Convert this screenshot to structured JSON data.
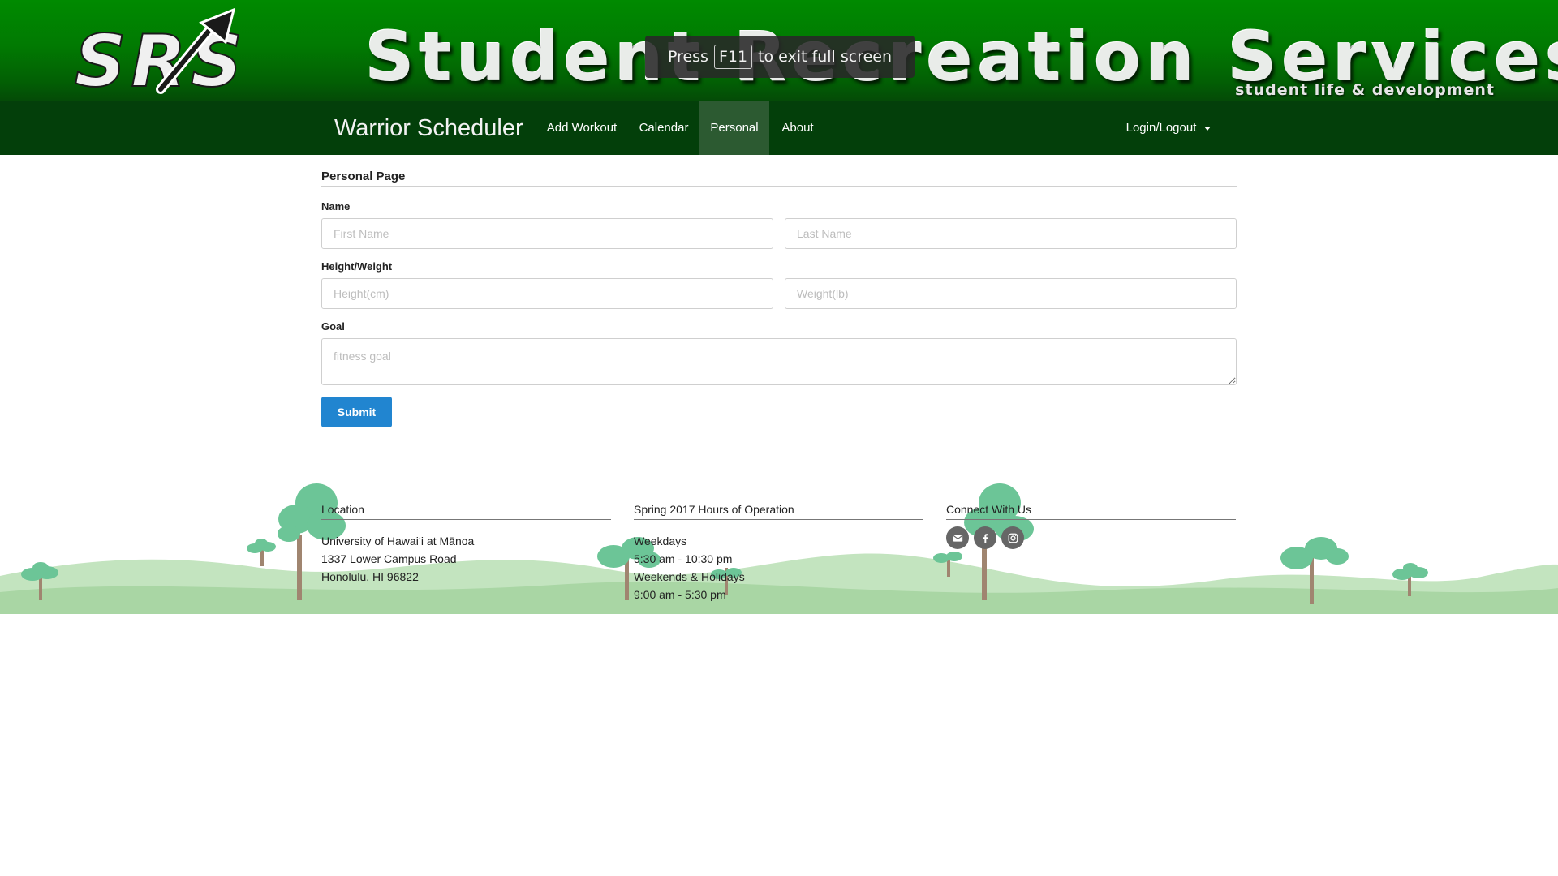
{
  "banner": {
    "logo_text": "SRS",
    "title": "Student Recreation Services",
    "subtitle": "student life & development",
    "colors": {
      "green_top": "#008a00",
      "green_bottom": "#044a07"
    }
  },
  "fullscreen_notice": {
    "press": "Press",
    "key": "F11",
    "rest": "to exit full screen"
  },
  "navbar": {
    "brand": "Warrior Scheduler",
    "items": [
      {
        "label": "Add Workout",
        "active": false
      },
      {
        "label": "Calendar",
        "active": false
      },
      {
        "label": "Personal",
        "active": true
      },
      {
        "label": "About",
        "active": false
      }
    ],
    "login": "Login/Logout",
    "login_icon": "caret-down-icon",
    "colors": {
      "background": "#033f0a",
      "active": "#2c5a31"
    }
  },
  "form": {
    "header": "Personal Page",
    "name_label": "Name",
    "first_name_placeholder": "First Name",
    "last_name_placeholder": "Last Name",
    "height_weight_label": "Height/Weight",
    "height_placeholder": "Height(cm)",
    "weight_placeholder": "Weight(lb)",
    "goal_label": "Goal",
    "goal_placeholder": "fitness goal",
    "submit_label": "Submit",
    "colors": {
      "submit": "#2185d0"
    }
  },
  "footer": {
    "location": {
      "title": "Location",
      "lines": [
        "University of Hawaiʻi at Mānoa",
        "1337 Lower Campus Road",
        "Honolulu, HI 96822"
      ]
    },
    "hours": {
      "title": "Spring 2017 Hours of Operation",
      "lines": [
        "Weekdays",
        "5:30 am - 10:30 pm",
        "Weekends & Holidays",
        "9:00 am - 5:30 pm"
      ]
    },
    "connect": {
      "title": "Connect With Us",
      "icons": [
        "envelope-icon",
        "facebook-icon",
        "instagram-icon"
      ]
    },
    "colors": {
      "hills": "#b4ddb0",
      "trees": "#6cc597",
      "trunks": "#a08570"
    }
  }
}
